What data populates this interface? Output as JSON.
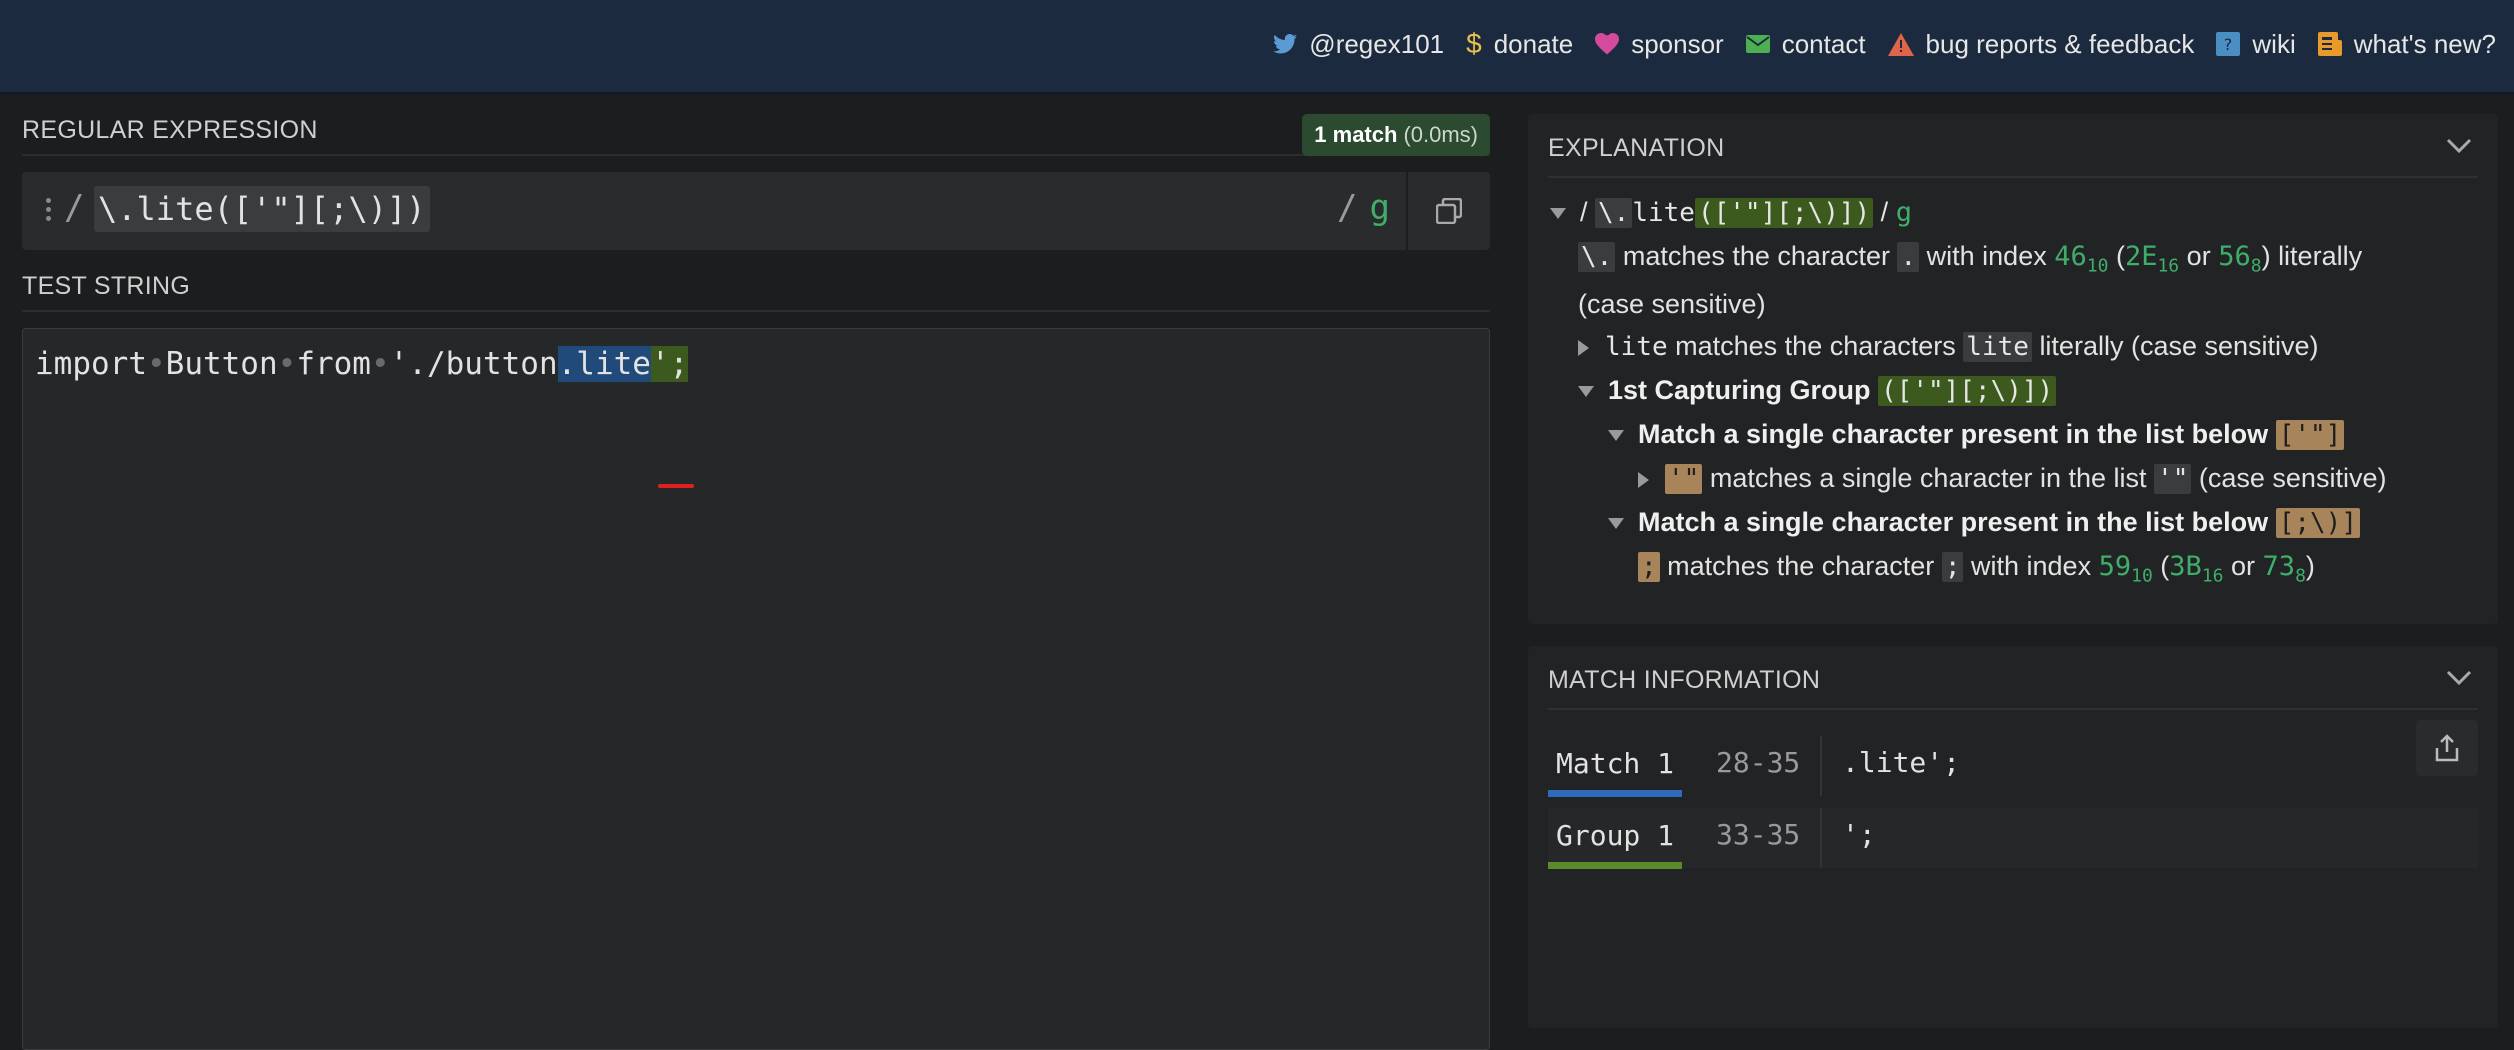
{
  "nav": {
    "twitter": "@regex101",
    "donate": "donate",
    "sponsor": "sponsor",
    "contact": "contact",
    "bugs": "bug reports & feedback",
    "wiki": "wiki",
    "whatsnew": "what's new?"
  },
  "regex": {
    "label": "REGULAR EXPRESSION",
    "match_count": "1 match",
    "match_time": "(0.0ms)",
    "open_delim": "/",
    "pattern": "\\.lite(['\"][;\\)])",
    "close_delim": "/",
    "flags": "g"
  },
  "test": {
    "label": "TEST STRING",
    "word1": "import",
    "word2": "Button",
    "word3": "from",
    "prefix": "'./button",
    "match_text": ".lite",
    "group_text": "';"
  },
  "explanation": {
    "title": "EXPLANATION",
    "root": {
      "delim_open": "/",
      "tok_escape": "\\.",
      "tok_lite": "lite",
      "tok_group": "(['\"][;\\)])",
      "delim_close": "/",
      "flag": "g"
    },
    "l1": {
      "tok": "\\.",
      "t1": "matches the character",
      "tok_char": ".",
      "t2": "with index",
      "dec": "46",
      "dec_base": "10",
      "hex": "2E",
      "hex_base": "16",
      "or": "or",
      "oct": "56",
      "oct_base": "8",
      "t3": "literally"
    },
    "l1b": "(case sensitive)",
    "l2": {
      "tok": "lite",
      "t1": "matches the characters",
      "tok2": "lite",
      "t2": "literally (case sensitive)"
    },
    "l3": {
      "title": "1st Capturing Group",
      "tok": "(['\"][;\\)])"
    },
    "l4": {
      "title": "Match a single character present in the list below",
      "tok": "['\"]"
    },
    "l5": {
      "tok": "'\"",
      "t1": "matches a single character in the list",
      "tok2": "'\"",
      "t2": "(case sensitive)"
    },
    "l6": {
      "title": "Match a single character present in the list below",
      "tok": "[;\\)]"
    },
    "l7": {
      "tok": ";",
      "t1": "matches the character",
      "tok2": ";",
      "t2": "with index",
      "dec": "59",
      "dec_base": "10",
      "hex": "3B",
      "hex_base": "16",
      "or": "or",
      "oct": "73",
      "oct_base": "8"
    }
  },
  "match_info": {
    "title": "MATCH INFORMATION",
    "rows": [
      {
        "label": "Match 1",
        "range": "28-35",
        "value": ".lite';"
      },
      {
        "label": "Group 1",
        "range": "33-35",
        "value": "';"
      }
    ]
  },
  "colors": {
    "topbar": "#1b2a3e",
    "match": "#1f4a7a",
    "group": "#3d5a1e",
    "accent_green": "#3fae6a"
  }
}
